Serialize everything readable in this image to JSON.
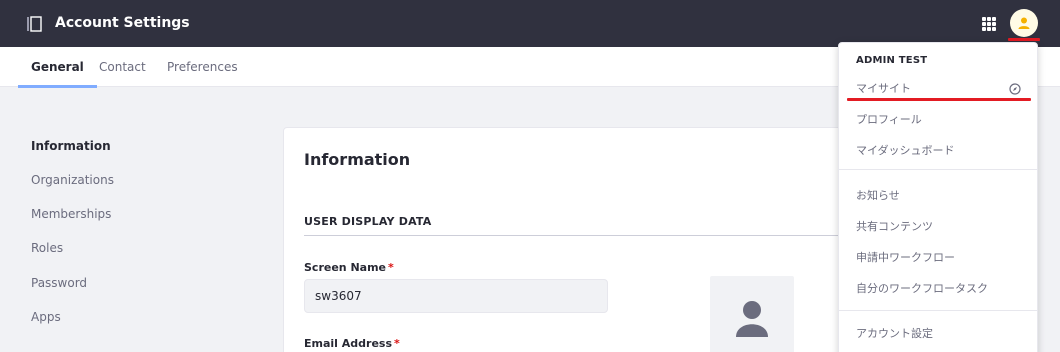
{
  "header": {
    "title": "Account Settings",
    "panel_icon": "product-menu-icon",
    "apps_icon": "apps-grid-icon",
    "avatar_icon": "user-avatar-icon"
  },
  "tabs": [
    {
      "label": "General",
      "active": true
    },
    {
      "label": "Contact",
      "active": false
    },
    {
      "label": "Preferences",
      "active": false
    }
  ],
  "sidebar": {
    "items": [
      {
        "label": "Information",
        "active": true
      },
      {
        "label": "Organizations",
        "active": false
      },
      {
        "label": "Memberships",
        "active": false
      },
      {
        "label": "Roles",
        "active": false
      },
      {
        "label": "Password",
        "active": false
      },
      {
        "label": "Apps",
        "active": false
      }
    ]
  },
  "main": {
    "title": "Information",
    "section_title": "USER DISPLAY DATA",
    "screen_name_label": "Screen Name",
    "screen_name_value": "sw3607",
    "email_label": "Email Address",
    "required_marker": "*"
  },
  "user_menu": {
    "header": "ADMIN TEST",
    "items": [
      {
        "label": "マイサイト",
        "icon": "compass-icon"
      },
      {
        "label": "プロフィール"
      },
      {
        "label": "マイダッシュボード"
      },
      {
        "label": "お知らせ"
      },
      {
        "label": "共有コンテンツ"
      },
      {
        "label": "申請中ワークフロー"
      },
      {
        "label": "自分のワークフロータスク"
      },
      {
        "label": "アカウント設定"
      }
    ]
  },
  "colors": {
    "topbar": "#30313f",
    "accent": "#80acff",
    "highlight": "#e31b23",
    "required": "#da1414",
    "avatar_bg": "#fffbe6",
    "avatar_fg": "#f5b100"
  }
}
